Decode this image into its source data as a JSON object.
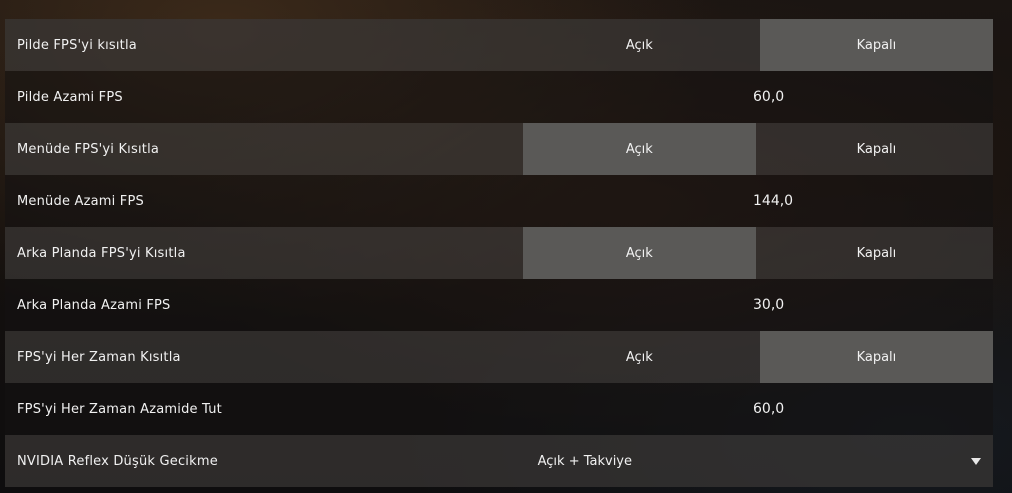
{
  "settings": {
    "rows": [
      {
        "label": "Pilde FPS'yi kısıtla",
        "on_label": "Açık",
        "off_label": "Kapalı",
        "selected": "off"
      },
      {
        "label": "Pilde Azami FPS",
        "value": "60,0"
      },
      {
        "label": "Menüde FPS'yi Kısıtla",
        "on_label": "Açık",
        "off_label": "Kapalı",
        "selected": "on"
      },
      {
        "label": "Menüde Azami FPS",
        "value": "144,0"
      },
      {
        "label": "Arka Planda FPS'yi Kısıtla",
        "on_label": "Açık",
        "off_label": "Kapalı",
        "selected": "on"
      },
      {
        "label": "Arka Planda Azami FPS",
        "value": "30,0"
      },
      {
        "label": "FPS'yi Her Zaman Kısıtla",
        "on_label": "Açık",
        "off_label": "Kapalı",
        "selected": "off"
      },
      {
        "label": "FPS'yi Her Zaman Azamide Tut",
        "value": "60,0"
      },
      {
        "label": "NVIDIA Reflex Düşük Gecikme",
        "dropdown_value": "Açık + Takviye",
        "icon": "chevron-down-icon"
      }
    ]
  }
}
